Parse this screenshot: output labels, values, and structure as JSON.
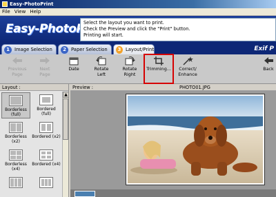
{
  "window": {
    "title": "Easy-PhotoPrint"
  },
  "menu": [
    "File",
    "View",
    "Help"
  ],
  "header": {
    "logo": "Easy-PhotoPrint",
    "instructions": [
      "Select the layout you want to print.",
      "Check the Preview and click the \"Print\" button.",
      "Printing will start."
    ]
  },
  "steps": [
    {
      "num": "1",
      "label": "Image Selection"
    },
    {
      "num": "2",
      "label": "Paper Selection"
    },
    {
      "num": "3",
      "label": "Layout/Print"
    }
  ],
  "brand": "Exif P",
  "toolbar": {
    "previous": [
      "Previous",
      "Page"
    ],
    "next": [
      "Next",
      "Page"
    ],
    "date": "Date",
    "rotate_left": [
      "Rotate",
      "Left"
    ],
    "rotate_right": [
      "Rotate",
      "Right"
    ],
    "trimming": "Trimming...",
    "correct": [
      "Correct/",
      "Enhance"
    ],
    "back": "Back"
  },
  "layout": {
    "heading": "Layout :",
    "items": [
      [
        "Borderless",
        "(full)"
      ],
      [
        "Bordered (full)"
      ],
      [
        "Borderless (x2)"
      ],
      [
        "Bordered (x2)"
      ],
      [
        "Borderless (x4)"
      ],
      [
        "Bordered (x4)"
      ]
    ]
  },
  "preview": {
    "heading": "Preview :",
    "filename": "PHOTO01.JPG"
  },
  "colors": {
    "accent_blue": "#0d2776",
    "highlight_red": "#d60000",
    "step_active": "#f2a22b"
  }
}
